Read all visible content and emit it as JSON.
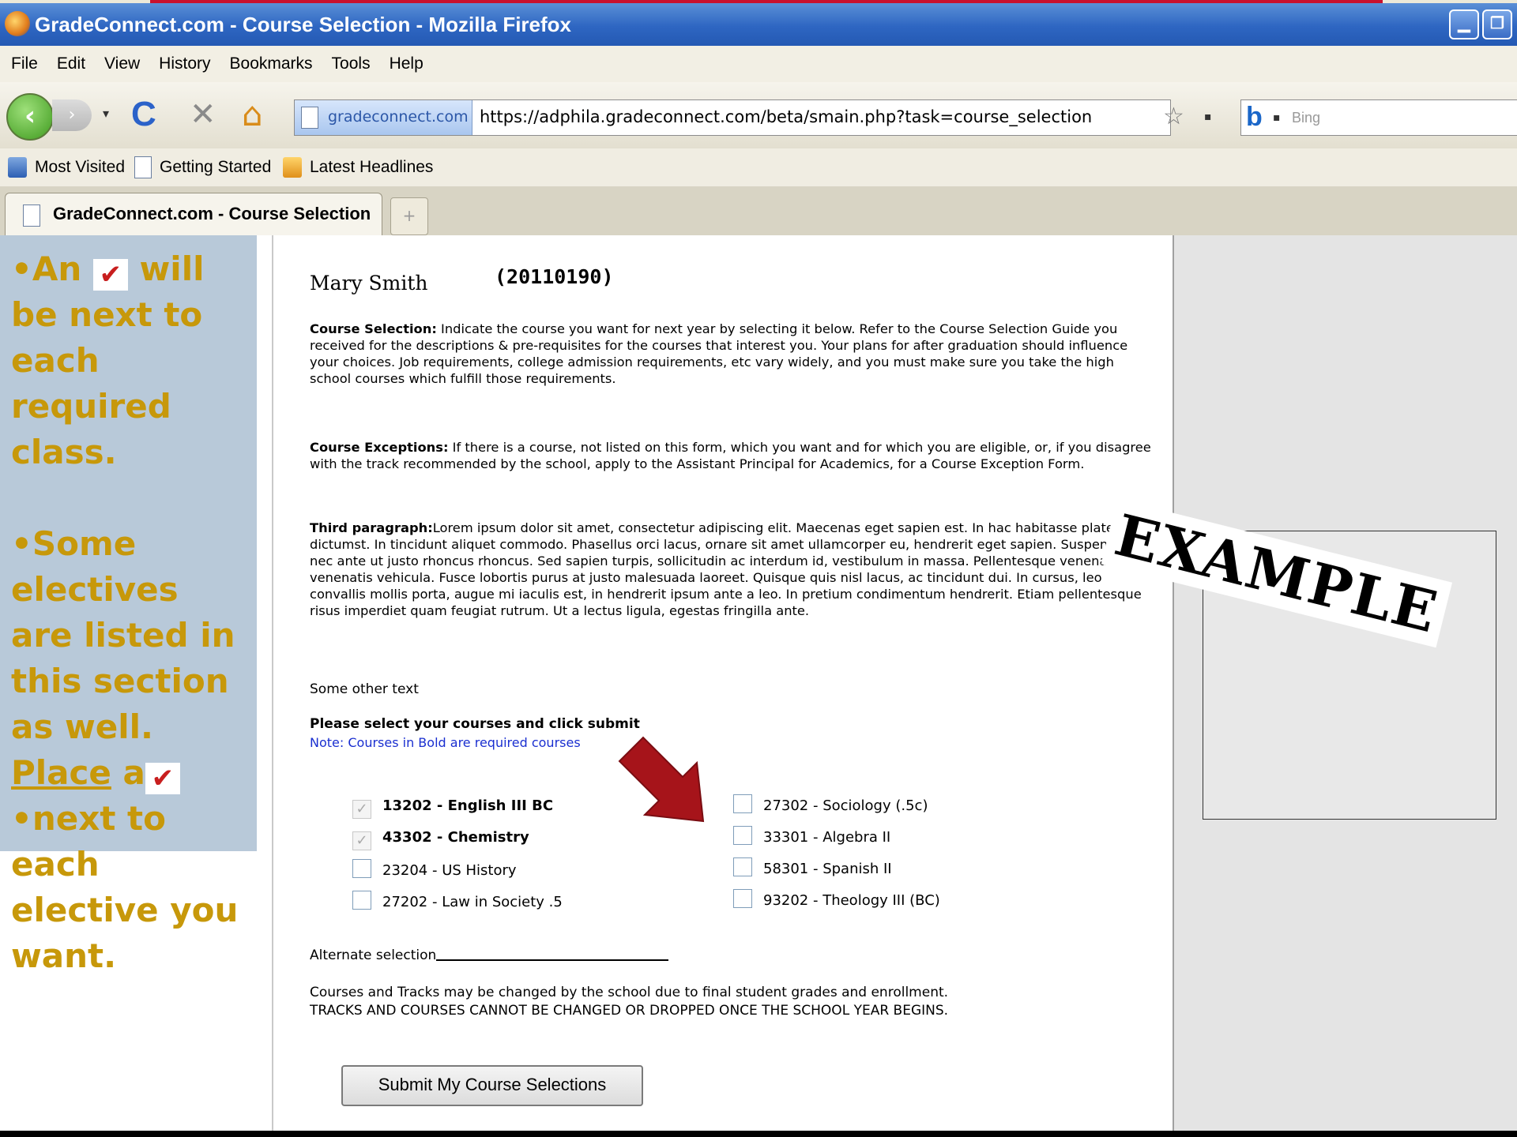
{
  "window": {
    "title": "GradeConnect.com - Course Selection - Mozilla Firefox",
    "controls": [
      "▁",
      "❐"
    ]
  },
  "menu": [
    "File",
    "Edit",
    "View",
    "History",
    "Bookmarks",
    "Tools",
    "Help"
  ],
  "nav": {
    "back": "‹",
    "forward": "›",
    "reload": "C",
    "stop": "✕",
    "home": "⌂",
    "site_identity": "gradeconnect.com",
    "url": "https://adphila.gradeconnect.com/beta/smain.php?task=course_selection",
    "bookmark_star": "☆",
    "search_logo": "b",
    "search_placeholder": "Bing"
  },
  "bookmarks": [
    "Most Visited",
    "Getting Started",
    "Latest Headlines"
  ],
  "tabs": [
    {
      "label": "GradeConnect.com - Course Selection"
    }
  ],
  "new_tab": "+",
  "overlay": {
    "line1a": "•An",
    "line1b": "will",
    "line2": "be next to",
    "line3": "each",
    "line4": "required",
    "line5": "class.",
    "line6": "•Some",
    "line7": "electives",
    "line8": "are listed in",
    "line9": "this section",
    "line10": "as well.",
    "line11a": "Place",
    "line11b": "a",
    "line12": "•next to",
    "line13": "each",
    "line14": "elective you",
    "line15": "want.",
    "check_glyph": "✔",
    "stamp": "EXAMPLE"
  },
  "student": {
    "name": "Mary Smith",
    "id": "(20110190)"
  },
  "paragraphs": {
    "selection_label": "Course Selection:",
    "selection_text": " Indicate the course you want for next year by selecting it below. Refer to the Course Selection Guide you received for the descriptions & pre-requisites for the courses that interest you. Your plans for after graduation should influence your choices. Job requirements, college admission requirements, etc vary widely, and you must make sure you take the high school courses which fulfill those requirements.",
    "exceptions_label": "Course Exceptions:",
    "exceptions_text": " If there is a course, not listed on this form, which you want and for which you are eligible, or, if you disagree with the track recommended by the school, apply to the Assistant Principal for Academics, for a Course Exception Form.",
    "third_label": "Third paragraph:",
    "third_text": "Lorem ipsum dolor sit amet, consectetur adipiscing elit. Maecenas eget sapien est. In hac habitasse platea dictumst. In tincidunt aliquet commodo. Phasellus orci lacus, ornare sit amet ullamcorper eu, hendrerit eget sapien. Suspendisse nec ante ut justo rhoncus rhoncus. Sed sapien turpis, sollicitudin ac interdum id, vestibulum in massa. Pellentesque venenatis venenatis vehicula. Fusce lobortis purus at justo malesuada laoreet. Quisque quis nisl lacus, ac tincidunt dui. In cursus, leo convallis mollis porta, augue mi iaculis est, in hendrerit ipsum ante a leo. In pretium condimentum hendrerit. Etiam pellentesque risus imperdiet quam feugiat rutrum. Ut a lectus ligula, egestas fringilla ante.",
    "other": "Some other text",
    "instruction": "Please select your courses and click submit",
    "note": "Note: Courses in Bold are required courses"
  },
  "courses": {
    "left": [
      {
        "label": "13202 - English III BC",
        "checked": true,
        "required": true
      },
      {
        "label": "43302 - Chemistry",
        "checked": true,
        "required": true
      },
      {
        "label": "23204 - US History",
        "checked": false,
        "required": false
      },
      {
        "label": "27202 - Law in Society .5",
        "checked": false,
        "required": false
      }
    ],
    "right": [
      {
        "label": "27302 - Sociology (.5c)",
        "checked": false,
        "required": false
      },
      {
        "label": "33301 - Algebra II",
        "checked": false,
        "required": false
      },
      {
        "label": "58301 - Spanish II",
        "checked": false,
        "required": false
      },
      {
        "label": "93202 - Theology III (BC)",
        "checked": false,
        "required": false
      }
    ],
    "check_glyph": "✓"
  },
  "alternate": "Alternate selection",
  "caption": {
    "line1": "Courses and Tracks may be changed by the school due to final student grades and enrollment.",
    "line2": "TRACKS AND COURSES CANNOT BE CHANGED OR DROPPED ONCE THE SCHOOL YEAR BEGINS."
  },
  "submit_label": "Submit My Course Selections",
  "colors": {
    "overlay_text": "#c7980a",
    "sidebar_bg": "#b8c9d9",
    "note_text": "#1a2fd0",
    "arrow": "#a6141a",
    "check": "#c81e1e"
  }
}
